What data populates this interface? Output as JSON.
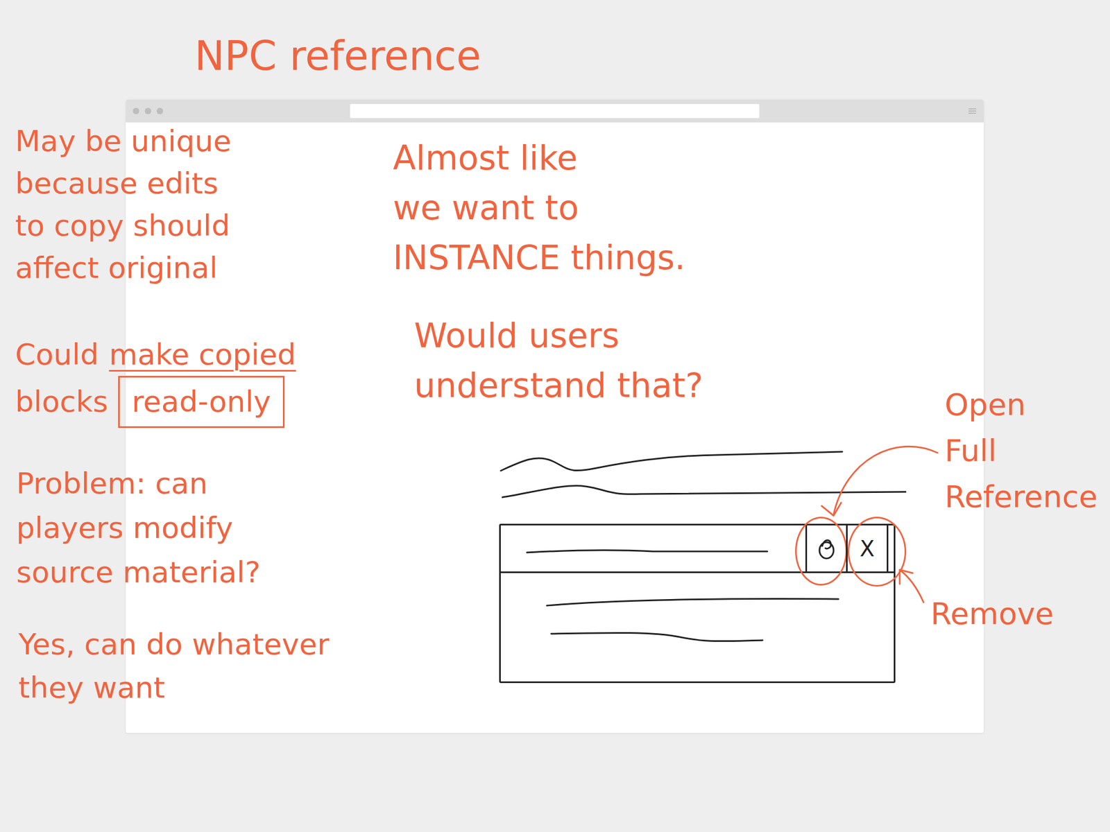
{
  "title": "NPC reference",
  "notes": [
    {
      "lines": [
        [
          {
            "text": "May be unique",
            "kind": "plain"
          }
        ],
        [
          {
            "text": "because edits",
            "kind": "plain"
          }
        ],
        [
          {
            "text": "to copy should",
            "kind": "plain"
          }
        ],
        [
          {
            "text": "affect original",
            "kind": "plain"
          }
        ]
      ]
    },
    {
      "lines": [
        [
          {
            "text": "Could",
            "kind": "plain"
          },
          {
            "text": "make copied",
            "kind": "underline"
          }
        ],
        [
          {
            "text": "blocks",
            "kind": "plain"
          },
          {
            "text": "read-only",
            "kind": "boxed"
          }
        ]
      ]
    },
    {
      "lines": [
        [
          {
            "text": "Problem: can",
            "kind": "plain"
          }
        ],
        [
          {
            "text": "players modify",
            "kind": "plain"
          }
        ],
        [
          {
            "text": "source material?",
            "kind": "plain"
          }
        ]
      ]
    },
    {
      "lines": [
        [
          {
            "text": "Yes, can do whatever",
            "kind": "plain"
          }
        ],
        [
          {
            "text": "they want",
            "kind": "plain"
          }
        ]
      ]
    },
    {
      "lines": [
        [
          {
            "text": "Almost like",
            "kind": "plain"
          }
        ],
        [
          {
            "text": "we want to",
            "kind": "plain"
          }
        ],
        [
          {
            "text": "INSTANCE things.",
            "kind": "plain"
          }
        ]
      ]
    },
    {
      "lines": [
        [
          {
            "text": "Would users",
            "kind": "plain"
          }
        ],
        [
          {
            "text": "understand that?",
            "kind": "plain"
          }
        ]
      ]
    }
  ],
  "sketch": {
    "remove_button": "X"
  },
  "annotations": [
    {
      "lines": [
        "Open",
        "Full",
        "Reference"
      ]
    },
    {
      "lines": [
        "Remove"
      ]
    }
  ]
}
